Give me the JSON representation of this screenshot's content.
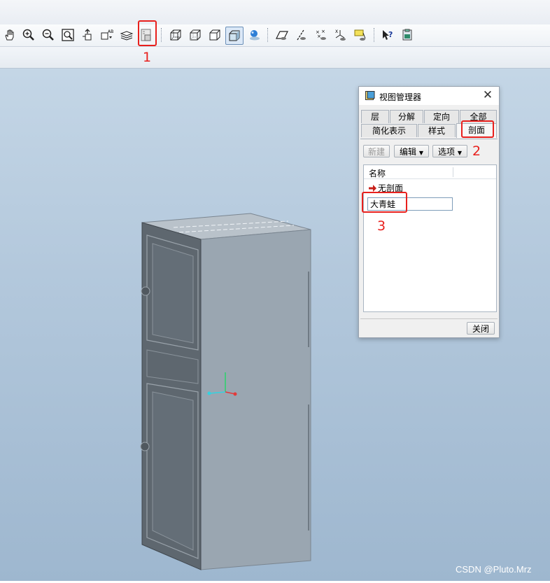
{
  "toolbar": {
    "buttons": [
      "pan-icon",
      "zoom-in-icon",
      "zoom-out-icon",
      "refit-icon",
      "reorient-icon",
      "saved-views-icon",
      "layers-icon",
      "view-manager-icon",
      "wireframe-icon",
      "hidden-line-icon",
      "no-hidden-icon",
      "shading-icon",
      "appearance-icon",
      "datum-planes-icon",
      "datum-axes-icon",
      "datum-points-icon",
      "coordinate-systems-icon",
      "annotations-icon",
      "whats-this-icon",
      "model-tree-icon"
    ]
  },
  "annotations": {
    "label1": "1",
    "label2": "2",
    "label3": "3"
  },
  "dialog": {
    "title": "视图管理器",
    "close_glyph": "✕",
    "tabs_row1": [
      "层",
      "分解",
      "定向",
      "全部"
    ],
    "tabs_row2": [
      "简化表示",
      "样式",
      "剖面"
    ],
    "selected_tab": "剖面",
    "buttons": {
      "new": "新建",
      "edit": "编辑",
      "options": "选项"
    },
    "list": {
      "header_name": "名称",
      "row_no_section": "无剖面",
      "edit_value": "大青蛙"
    },
    "close_button": "关闭"
  },
  "watermark": "CSDN @Pluto.Mrz",
  "colors": {
    "accent_red": "#e8201d",
    "viewport_top": "#c4d6e6",
    "viewport_bottom": "#9eb7cf",
    "model_face_front": "#9aa6b1",
    "model_face_side": "#5e676f"
  }
}
